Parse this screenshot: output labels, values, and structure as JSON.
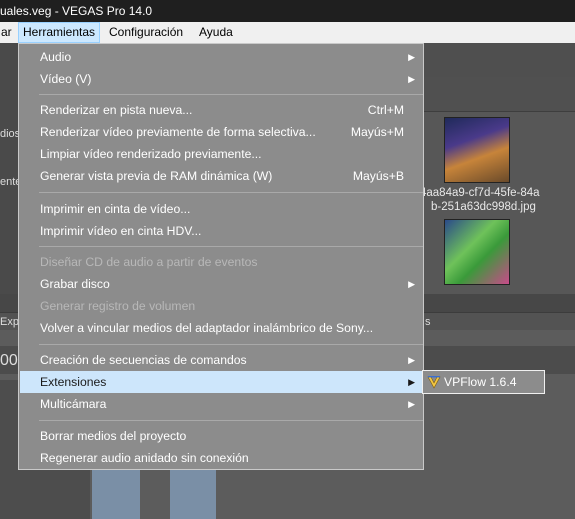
{
  "title_bar": {
    "text": "uales.veg - VEGAS Pro 14.0"
  },
  "menubar": {
    "items": [
      {
        "label": "ar"
      },
      {
        "label": "Herramientas"
      },
      {
        "label": "Configuración"
      },
      {
        "label": "Ayuda"
      }
    ]
  },
  "background": {
    "left_labels": [
      "dios",
      "ente"
    ],
    "thumbnail_caption_lines": [
      "4aa84a9-cf7d-45fe-84a",
      "b-251a63dc998d.jpg"
    ],
    "tab_labels": [
      "Exp",
      "s"
    ],
    "timeline_label": "00"
  },
  "menu": {
    "items": [
      {
        "label": "Audio",
        "shortcut": "",
        "submenu": true,
        "disabled": false
      },
      {
        "label": "Vídeo (V)",
        "shortcut": "",
        "submenu": true,
        "disabled": false
      },
      {
        "label": "Renderizar en pista nueva...",
        "shortcut": "Ctrl+M",
        "submenu": false,
        "disabled": false
      },
      {
        "label": "Renderizar vídeo previamente de forma selectiva...",
        "shortcut": "Mayús+M",
        "submenu": false,
        "disabled": false
      },
      {
        "label": "Limpiar vídeo renderizado previamente...",
        "shortcut": "",
        "submenu": false,
        "disabled": false
      },
      {
        "label": "Generar vista previa de RAM dinámica (W)",
        "shortcut": "Mayús+B",
        "submenu": false,
        "disabled": false
      },
      {
        "label": "Imprimir en cinta de vídeo...",
        "shortcut": "",
        "submenu": false,
        "disabled": false
      },
      {
        "label": "Imprimir vídeo en cinta  HDV...",
        "shortcut": "",
        "submenu": false,
        "disabled": false
      },
      {
        "label": "Diseñar CD de audio a partir de eventos",
        "shortcut": "",
        "submenu": false,
        "disabled": true
      },
      {
        "label": "Grabar disco",
        "shortcut": "",
        "submenu": true,
        "disabled": false
      },
      {
        "label": "Generar registro de volumen",
        "shortcut": "",
        "submenu": false,
        "disabled": true
      },
      {
        "label": "Volver a vincular medios del adaptador inalámbrico de Sony...",
        "shortcut": "",
        "submenu": false,
        "disabled": false
      },
      {
        "label": "Creación de secuencias de comandos",
        "shortcut": "",
        "submenu": true,
        "disabled": false
      },
      {
        "label": "Extensiones",
        "shortcut": "",
        "submenu": true,
        "disabled": false
      },
      {
        "label": "Multicámara",
        "shortcut": "",
        "submenu": true,
        "disabled": false
      },
      {
        "label": "Borrar medios del proyecto",
        "shortcut": "",
        "submenu": false,
        "disabled": false
      },
      {
        "label": "Regenerar audio anidado sin conexión",
        "shortcut": "",
        "submenu": false,
        "disabled": false
      }
    ]
  },
  "submenu": {
    "items": [
      {
        "label": "VPFlow 1.6.4",
        "icon": "vpflow-icon"
      }
    ]
  },
  "colors": {
    "menu_bg": "#8c8c8c",
    "highlight": "#cde6fb",
    "menubar_active": "#cce8ff"
  }
}
